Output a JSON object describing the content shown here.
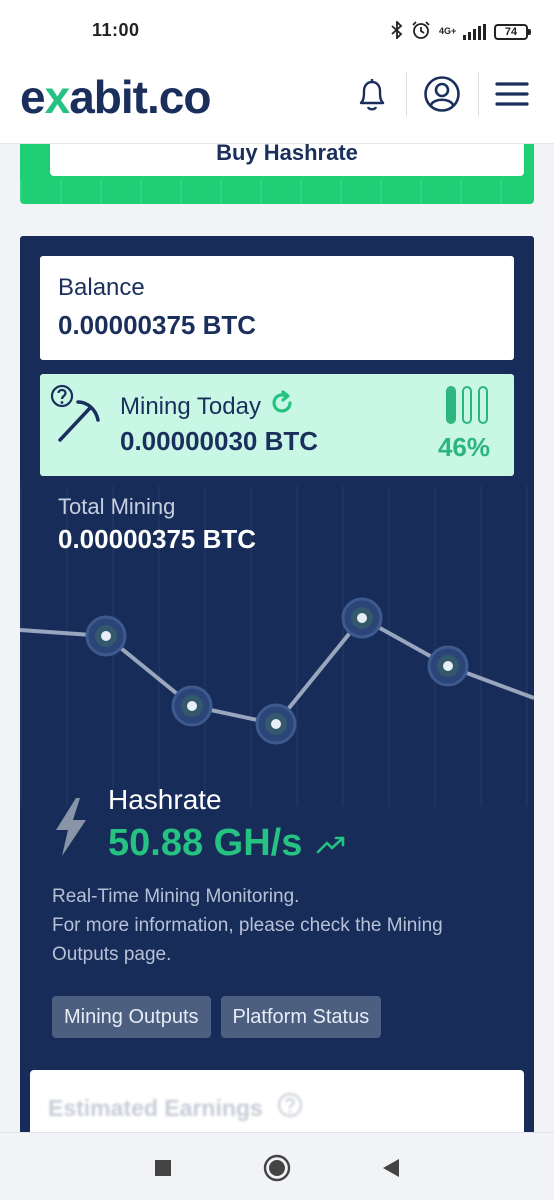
{
  "status_bar": {
    "time": "11:00",
    "network": "4G+",
    "battery": "74"
  },
  "header": {
    "logo_text_pre": "e",
    "logo_text_x": "x",
    "logo_text_post": "abit.co",
    "icons": [
      "bell-icon",
      "user-icon",
      "menu-icon"
    ]
  },
  "buy_banner": {
    "button_label": "Buy Hashrate"
  },
  "dashboard": {
    "balance": {
      "label": "Balance",
      "value": "0.00000375 BTC"
    },
    "mining_today": {
      "label": "Mining Today",
      "value": "0.00000030 BTC",
      "percent_label": "46%",
      "gauge_levels": [
        1.0,
        0.0,
        0.0
      ]
    },
    "total_mining": {
      "label": "Total Mining",
      "value": "0.00000375 BTC"
    },
    "hashrate": {
      "label": "Hashrate",
      "value": "50.88 GH/s",
      "desc_line1": "Real-Time Mining Monitoring.",
      "desc_line2": "For more information, please check the Mining",
      "desc_line3": "Outputs page."
    },
    "buttons": {
      "mining_outputs": "Mining Outputs",
      "platform_status": "Platform Status"
    },
    "estimated_earnings": {
      "title": "Estimated Earnings"
    }
  },
  "colors": {
    "navy": "#172c59",
    "green": "#26c281",
    "mint": "#c9f7e5"
  }
}
